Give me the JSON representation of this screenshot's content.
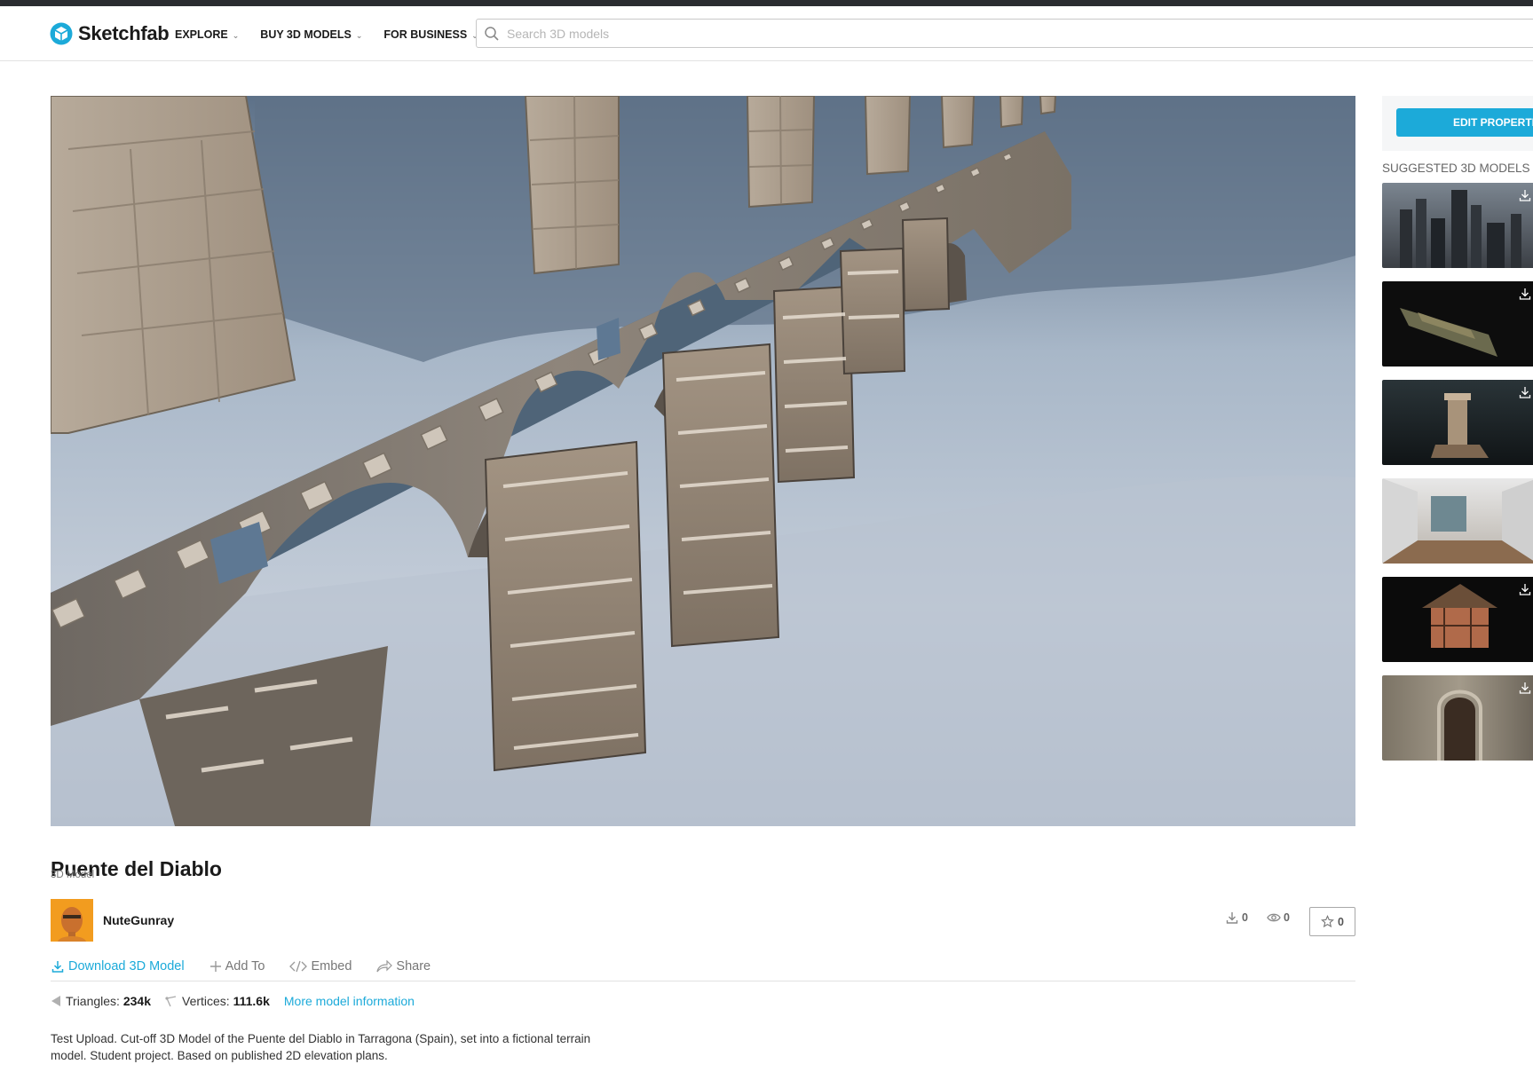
{
  "brand": {
    "name": "Sketchfab",
    "accent": "#1caad9"
  },
  "nav": {
    "items": [
      {
        "label": "EXPLORE"
      },
      {
        "label": "BUY 3D MODELS"
      },
      {
        "label": "FOR BUSINESS"
      }
    ],
    "search_placeholder": "Search 3D models"
  },
  "model": {
    "title": "Puente del Diablo",
    "type": "3D Model",
    "author": "NuteGunray",
    "downloads": "0",
    "views": "0",
    "likes": "0",
    "description": "Test Upload. Cut-off 3D Model of the Puente del Diablo in Tarragona (Spain), set into a fictional terrain model. Student project. Based on published 2D elevation plans."
  },
  "actions": {
    "download": "Download 3D Model",
    "add_to": "Add To",
    "embed": "Embed",
    "share": "Share"
  },
  "specs": {
    "triangles_label": "Triangles:",
    "triangles_value": "234k",
    "vertices_label": "Vertices:",
    "vertices_value": "111.6k",
    "more_info": "More model information"
  },
  "sidebar": {
    "edit_button": "EDIT PROPERTIES",
    "suggested_title": "SUGGESTED 3D MODELS",
    "thumbnails": [
      {
        "icon": "city-skyline"
      },
      {
        "icon": "terrain-scan"
      },
      {
        "icon": "column-ruin"
      },
      {
        "icon": "gallery-interior"
      },
      {
        "icon": "wooden-house"
      },
      {
        "icon": "stone-doorway"
      }
    ]
  }
}
